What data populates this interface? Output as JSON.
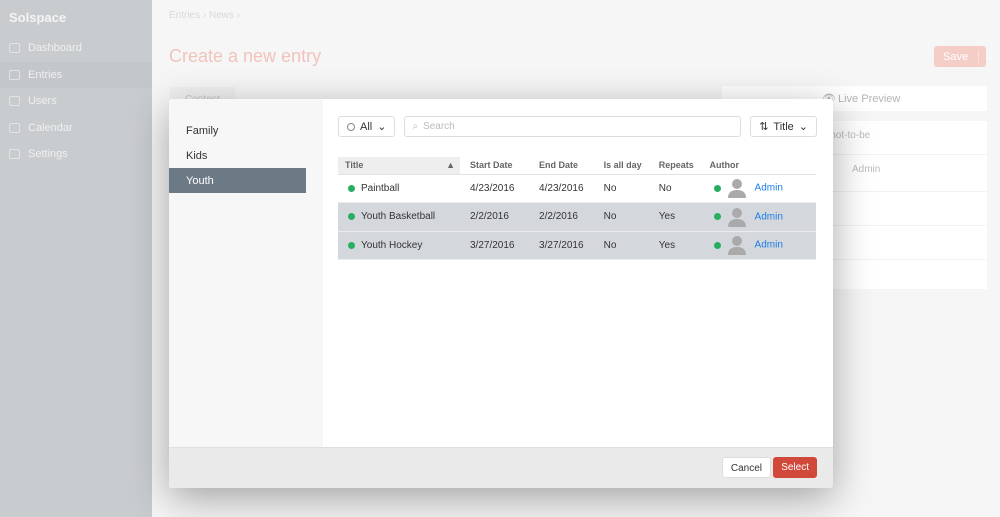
{
  "sidebar": {
    "brand": "Solspace",
    "items": [
      {
        "label": "Dashboard"
      },
      {
        "label": "Entries"
      },
      {
        "label": "Users"
      },
      {
        "label": "Calendar"
      },
      {
        "label": "Settings"
      }
    ]
  },
  "header": {
    "breadcrumb": "Entries › News ›",
    "title": "Create a new entry",
    "save": "Save"
  },
  "content_tab": "Content",
  "right_panel": {
    "live_preview": "Live Preview",
    "slug": "or-not-to-be",
    "author": "Admin"
  },
  "modal": {
    "sources": [
      {
        "label": "Family"
      },
      {
        "label": "Kids"
      },
      {
        "label": "Youth"
      }
    ],
    "status_filter": "All",
    "search_placeholder": "Search",
    "sort": "Title",
    "columns": [
      "Title",
      "Start Date",
      "End Date",
      "Is all day",
      "Repeats",
      "Author"
    ],
    "rows": [
      {
        "title": "Paintball",
        "start": "4/23/2016",
        "end": "4/23/2016",
        "allday": "No",
        "repeats": "No",
        "author": "Admin"
      },
      {
        "title": "Youth Basketball",
        "start": "2/2/2016",
        "end": "2/2/2016",
        "allday": "No",
        "repeats": "Yes",
        "author": "Admin"
      },
      {
        "title": "Youth Hockey",
        "start": "3/27/2016",
        "end": "3/27/2016",
        "allday": "No",
        "repeats": "Yes",
        "author": "Admin"
      }
    ],
    "cancel": "Cancel",
    "select": "Select"
  },
  "colors": {
    "accent": "#da5a47",
    "status": "#27ae60",
    "link": "#1c7fe6",
    "selected_source": "#6c7a86"
  }
}
